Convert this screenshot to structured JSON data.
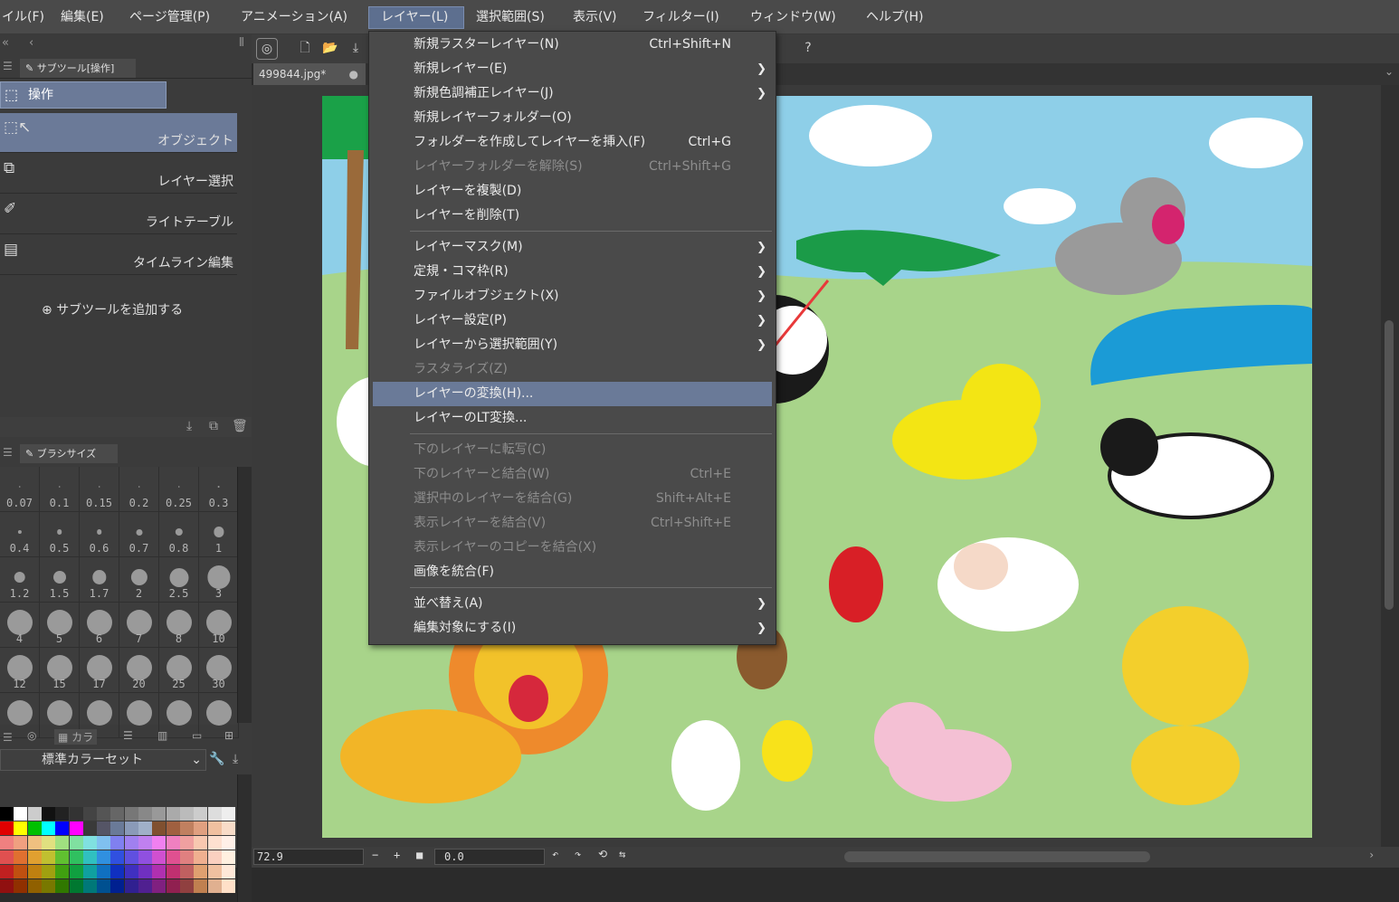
{
  "menubar": {
    "items": [
      "イル(F)",
      "編集(E)",
      "ページ管理(P)",
      "アニメーション(A)",
      "レイヤー(L)",
      "選択範囲(S)",
      "表示(V)",
      "フィルター(I)",
      "ウィンドウ(W)",
      "ヘルプ(H)"
    ]
  },
  "panels": {
    "subtool_tab": "サブツール[操作]",
    "main_tool": "操作",
    "subtools": [
      "オブジェクト",
      "レイヤー選択",
      "ライトテーブル",
      "タイムライン編集"
    ],
    "add_subtool": "サブツールを追加する",
    "brush_tab": "ブラシサイズ",
    "color_tab": "カラ",
    "color_set": "標準カラーセット"
  },
  "brush_sizes": [
    "0.07",
    "0.1",
    "0.15",
    "0.2",
    "0.25",
    "0.3",
    "0.4",
    "0.5",
    "0.6",
    "0.7",
    "0.8",
    "1",
    "1.2",
    "1.5",
    "1.7",
    "2",
    "2.5",
    "3",
    "4",
    "5",
    "6",
    "7",
    "8",
    "10",
    "12",
    "15",
    "17",
    "20",
    "25",
    "30",
    "",
    "",
    "",
    "",
    "",
    ""
  ],
  "document": {
    "tab_title": "499844.jpg*"
  },
  "status": {
    "zoom": "72.9",
    "angle": "0.0"
  },
  "layer_menu": {
    "items": [
      {
        "label": "新規ラスターレイヤー(N)",
        "shortcut": "Ctrl+Shift+N",
        "submenu": false,
        "disabled": false,
        "highlight": false
      },
      {
        "label": "新規レイヤー(E)",
        "shortcut": "",
        "submenu": true,
        "disabled": false,
        "highlight": false
      },
      {
        "label": "新規色調補正レイヤー(J)",
        "shortcut": "",
        "submenu": true,
        "disabled": false,
        "highlight": false
      },
      {
        "label": "新規レイヤーフォルダー(O)",
        "shortcut": "",
        "submenu": false,
        "disabled": false,
        "highlight": false
      },
      {
        "label": "フォルダーを作成してレイヤーを挿入(F)",
        "shortcut": "Ctrl+G",
        "submenu": false,
        "disabled": false,
        "highlight": false
      },
      {
        "label": "レイヤーフォルダーを解除(S)",
        "shortcut": "Ctrl+Shift+G",
        "submenu": false,
        "disabled": true,
        "highlight": false
      },
      {
        "label": "レイヤーを複製(D)",
        "shortcut": "",
        "submenu": false,
        "disabled": false,
        "highlight": false
      },
      {
        "label": "レイヤーを削除(T)",
        "shortcut": "",
        "submenu": false,
        "disabled": false,
        "highlight": false
      },
      {
        "label": "レイヤーマスク(M)",
        "shortcut": "",
        "submenu": true,
        "disabled": false,
        "highlight": false
      },
      {
        "label": "定規・コマ枠(R)",
        "shortcut": "",
        "submenu": true,
        "disabled": false,
        "highlight": false
      },
      {
        "label": "ファイルオブジェクト(X)",
        "shortcut": "",
        "submenu": true,
        "disabled": false,
        "highlight": false
      },
      {
        "label": "レイヤー設定(P)",
        "shortcut": "",
        "submenu": true,
        "disabled": false,
        "highlight": false
      },
      {
        "label": "レイヤーから選択範囲(Y)",
        "shortcut": "",
        "submenu": true,
        "disabled": false,
        "highlight": false
      },
      {
        "label": "ラスタライズ(Z)",
        "shortcut": "",
        "submenu": false,
        "disabled": true,
        "highlight": false
      },
      {
        "label": "レイヤーの変換(H)...",
        "shortcut": "",
        "submenu": false,
        "disabled": false,
        "highlight": true
      },
      {
        "label": "レイヤーのLT変換...",
        "shortcut": "",
        "submenu": false,
        "disabled": false,
        "highlight": false
      },
      {
        "label": "下のレイヤーに転写(C)",
        "shortcut": "",
        "submenu": false,
        "disabled": true,
        "highlight": false
      },
      {
        "label": "下のレイヤーと結合(W)",
        "shortcut": "Ctrl+E",
        "submenu": false,
        "disabled": true,
        "highlight": false
      },
      {
        "label": "選択中のレイヤーを結合(G)",
        "shortcut": "Shift+Alt+E",
        "submenu": false,
        "disabled": true,
        "highlight": false
      },
      {
        "label": "表示レイヤーを結合(V)",
        "shortcut": "Ctrl+Shift+E",
        "submenu": false,
        "disabled": true,
        "highlight": false
      },
      {
        "label": "表示レイヤーのコピーを結合(X)",
        "shortcut": "",
        "submenu": false,
        "disabled": true,
        "highlight": false
      },
      {
        "label": "画像を統合(F)",
        "shortcut": "",
        "submenu": false,
        "disabled": false,
        "highlight": false
      },
      {
        "label": "並べ替え(A)",
        "shortcut": "",
        "submenu": true,
        "disabled": false,
        "highlight": false
      },
      {
        "label": "編集対象にする(I)",
        "shortcut": "",
        "submenu": true,
        "disabled": false,
        "highlight": false
      }
    ]
  },
  "colors": {
    "sky": "#8ecfe8",
    "grass": "#a8d48a",
    "highlight": "#6a7a98",
    "arrow": "#e8393a"
  }
}
